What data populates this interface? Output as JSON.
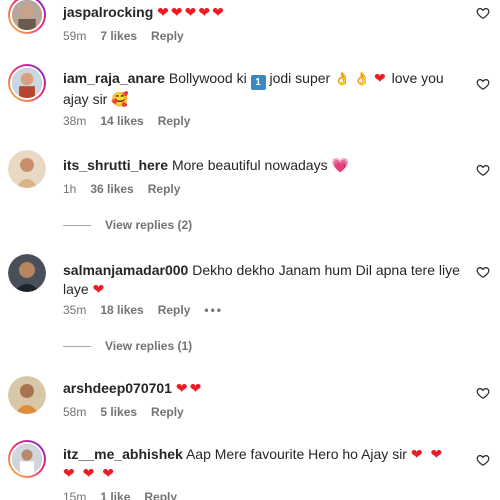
{
  "comments": [
    {
      "username": "jaspalrocking",
      "text": "",
      "time": "59m",
      "likes": "7 likes",
      "reply": "Reply"
    },
    {
      "username": "iam_raja_anare",
      "text_part1": "Bollywood ki",
      "emoji_box": "1",
      "text_part2": "jodi super",
      "text_part3": "love you",
      "text_line2": "ajay sir",
      "time": "38m",
      "likes": "14 likes",
      "reply": "Reply"
    },
    {
      "username": "its_shrutti_here",
      "text": "More beautiful nowadays",
      "time": "1h",
      "likes": "36 likes",
      "reply": "Reply",
      "view_replies": "View replies (2)"
    },
    {
      "username": "salmanjamadar000",
      "text": "Dekho dekho Janam hum Dil apna tere liye",
      "text_line2": "laye",
      "time": "35m",
      "likes": "18 likes",
      "reply": "Reply",
      "more": "•••",
      "view_replies": "View replies (1)"
    },
    {
      "username": "arshdeep070701",
      "time": "58m",
      "likes": "5 likes",
      "reply": "Reply"
    },
    {
      "username": "itz__me_abhishek",
      "text": "Aap Mere favourite Hero ho Ajay sir",
      "time": "15m",
      "likes": "1 like",
      "reply": "Reply"
    }
  ],
  "colors": {
    "heart_red": "#ed1c24",
    "meta_gray": "#737373",
    "text_dark": "#262626"
  },
  "icons": [
    "heart-outline-icon",
    "red-heart-emoji",
    "pink-heart-emoji",
    "clap-emoji",
    "keycap-one-emoji"
  ]
}
